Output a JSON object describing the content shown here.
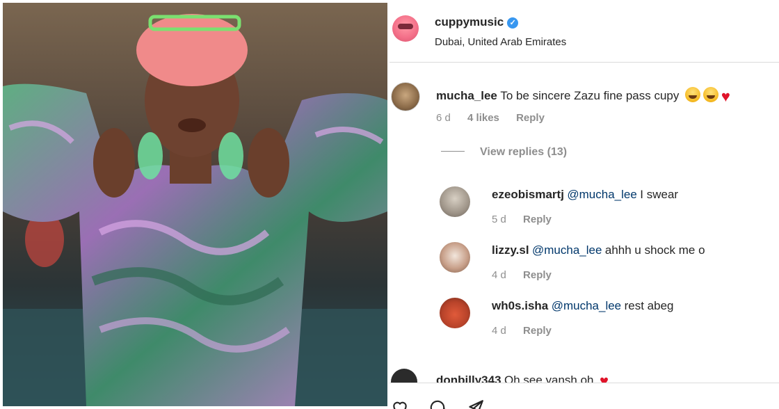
{
  "post": {
    "username": "cuppymusic",
    "verified": true,
    "location": "Dubai, United Arab Emirates"
  },
  "comments": [
    {
      "username": "mucha_lee",
      "text": "To be sincere Zazu fine pass cupy",
      "time": "6 d",
      "likes": "4 likes",
      "reply_label": "Reply",
      "view_replies": "View replies (13)"
    }
  ],
  "replies": [
    {
      "username": "ezeobismartj",
      "mention": "@mucha_lee",
      "text": "I swear",
      "time": "5 d",
      "reply_label": "Reply"
    },
    {
      "username": "lizzy.sl",
      "mention": "@mucha_lee",
      "text": "ahhh u shock me o",
      "time": "4 d",
      "reply_label": "Reply"
    },
    {
      "username": "wh0s.isha",
      "mention": "@mucha_lee",
      "text": "rest abeg",
      "time": "4 d",
      "reply_label": "Reply"
    }
  ],
  "partial_comment": {
    "username": "donbilly343",
    "text": "Oh see yansh oh"
  },
  "icons": {
    "verified": "verified-badge-icon",
    "like": "heart-outline-icon",
    "comment": "speech-bubble-icon",
    "share": "paper-plane-icon"
  },
  "colors": {
    "verified_blue": "#3897f0",
    "mention_blue": "#00376b",
    "heart_red": "#e0142a",
    "meta_gray": "#8e8e8e"
  }
}
